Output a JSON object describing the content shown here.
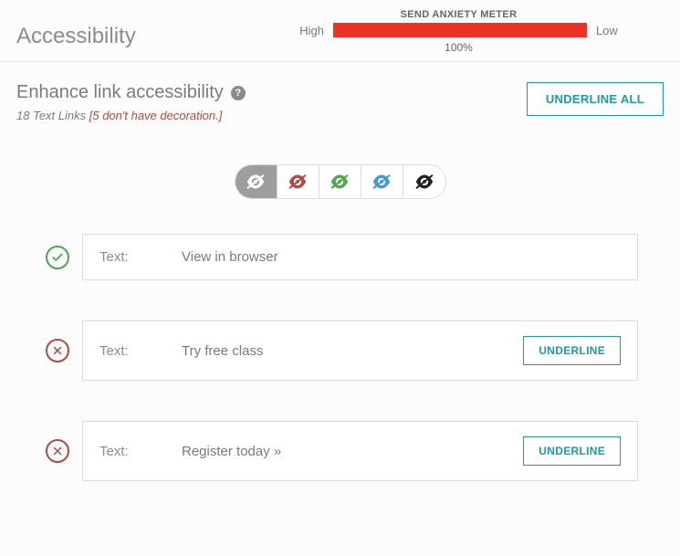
{
  "header": {
    "title": "Accessibility",
    "meter": {
      "label": "SEND ANXIETY METER",
      "left": "High",
      "right": "Low",
      "percent": "100%",
      "fill_color": "#ee3124"
    }
  },
  "section": {
    "title": "Enhance link accessibility",
    "subline_count": "18 Text Links",
    "subline_warn": "[5 don't have decoration.]",
    "underline_all": "UNDERLINE ALL"
  },
  "filters": [
    {
      "name": "vision-white",
      "color": "#ffffff",
      "active": true
    },
    {
      "name": "vision-red",
      "color": "#b24a41",
      "active": false
    },
    {
      "name": "vision-green",
      "color": "#4fa84f",
      "active": false
    },
    {
      "name": "vision-blue",
      "color": "#3f9bd8",
      "active": false
    },
    {
      "name": "vision-black",
      "color": "#222222",
      "active": false
    }
  ],
  "links": [
    {
      "status": "ok",
      "label": "Text:",
      "text": "View in browser",
      "action": null
    },
    {
      "status": "bad",
      "label": "Text:",
      "text": "Try free class",
      "action": "UNDERLINE"
    },
    {
      "status": "bad",
      "label": "Text:",
      "text": "Register today »",
      "action": "UNDERLINE"
    }
  ]
}
